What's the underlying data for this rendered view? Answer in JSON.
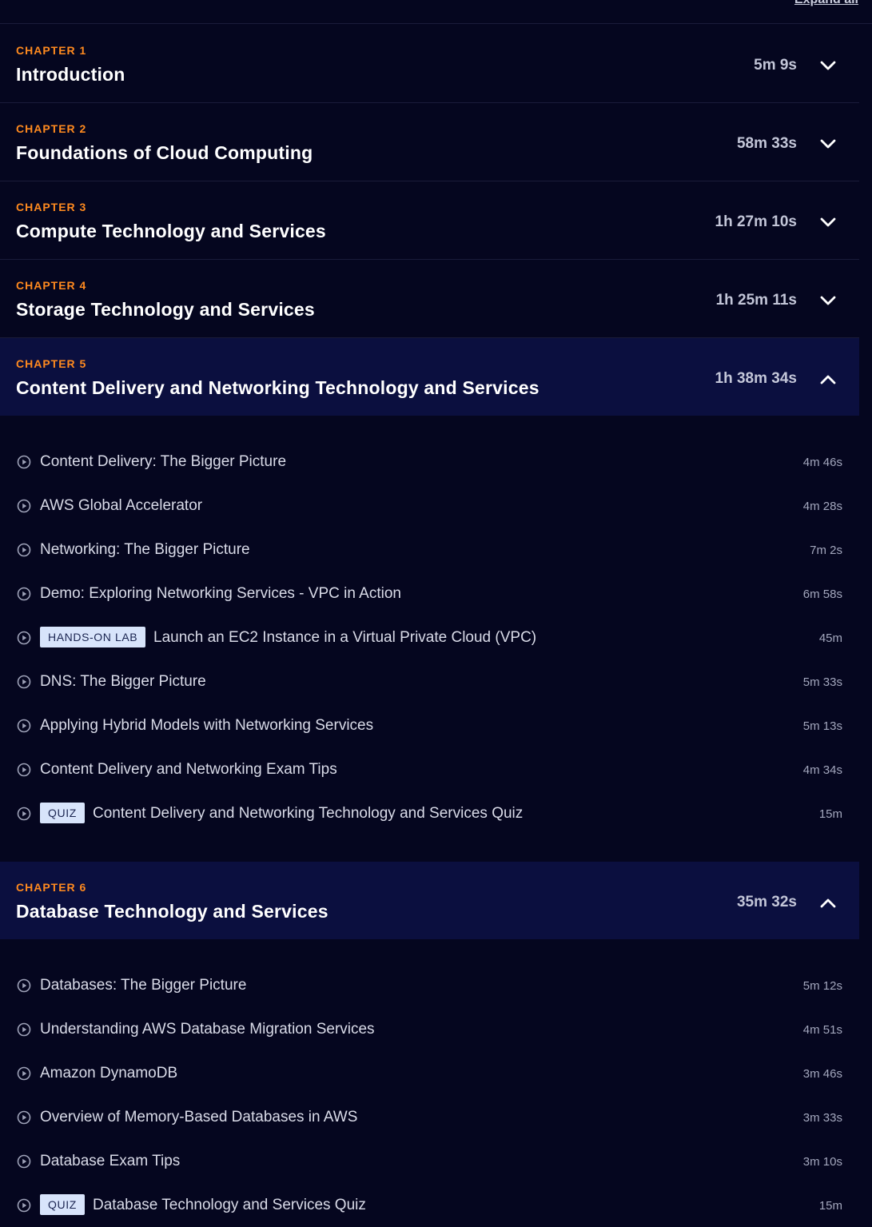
{
  "expand_all": "Expand all",
  "chapters": [
    {
      "number": "CHAPTER 1",
      "title": "Introduction",
      "duration": "5m 9s",
      "expanded": false
    },
    {
      "number": "CHAPTER 2",
      "title": "Foundations of Cloud Computing",
      "duration": "58m 33s",
      "expanded": false
    },
    {
      "number": "CHAPTER 3",
      "title": "Compute Technology and Services",
      "duration": "1h 27m 10s",
      "expanded": false
    },
    {
      "number": "CHAPTER 4",
      "title": "Storage Technology and Services",
      "duration": "1h 25m 11s",
      "expanded": false
    },
    {
      "number": "CHAPTER 5",
      "title": "Content Delivery and Networking Technology and Services",
      "duration": "1h 38m 34s",
      "expanded": true,
      "lessons": [
        {
          "tag": "",
          "title": "Content Delivery: The Bigger Picture",
          "duration": "4m 46s"
        },
        {
          "tag": "",
          "title": "AWS Global Accelerator",
          "duration": "4m 28s"
        },
        {
          "tag": "",
          "title": "Networking: The Bigger Picture",
          "duration": "7m 2s"
        },
        {
          "tag": "",
          "title": "Demo: Exploring Networking Services - VPC in Action",
          "duration": "6m 58s"
        },
        {
          "tag": "HANDS-ON LAB",
          "title": "Launch an EC2 Instance in a Virtual Private Cloud (VPC)",
          "duration": "45m"
        },
        {
          "tag": "",
          "title": "DNS: The Bigger Picture",
          "duration": "5m 33s"
        },
        {
          "tag": "",
          "title": "Applying Hybrid Models with Networking Services",
          "duration": "5m 13s"
        },
        {
          "tag": "",
          "title": "Content Delivery and Networking Exam Tips",
          "duration": "4m 34s"
        },
        {
          "tag": "QUIZ",
          "title": "Content Delivery and Networking Technology and Services Quiz",
          "duration": "15m"
        }
      ]
    },
    {
      "number": "CHAPTER 6",
      "title": "Database Technology and Services",
      "duration": "35m 32s",
      "expanded": true,
      "lessons": [
        {
          "tag": "",
          "title": "Databases: The Bigger Picture",
          "duration": "5m 12s"
        },
        {
          "tag": "",
          "title": "Understanding AWS Database Migration Services",
          "duration": "4m 51s"
        },
        {
          "tag": "",
          "title": "Amazon DynamoDB",
          "duration": "3m 46s"
        },
        {
          "tag": "",
          "title": "Overview of Memory-Based Databases in AWS",
          "duration": "3m 33s"
        },
        {
          "tag": "",
          "title": "Database Exam Tips",
          "duration": "3m 10s"
        },
        {
          "tag": "QUIZ",
          "title": "Database Technology and Services Quiz",
          "duration": "15m"
        }
      ]
    }
  ],
  "colors": {
    "background": "#05061f",
    "chapter_label": "#ff8a1f",
    "open_header": "#0b0f3f",
    "tag_bg": "#d8e4fb"
  },
  "icons": {
    "lesson": "play-circle-icon",
    "collapsed": "chevron-down-icon",
    "expanded": "chevron-up-icon"
  }
}
